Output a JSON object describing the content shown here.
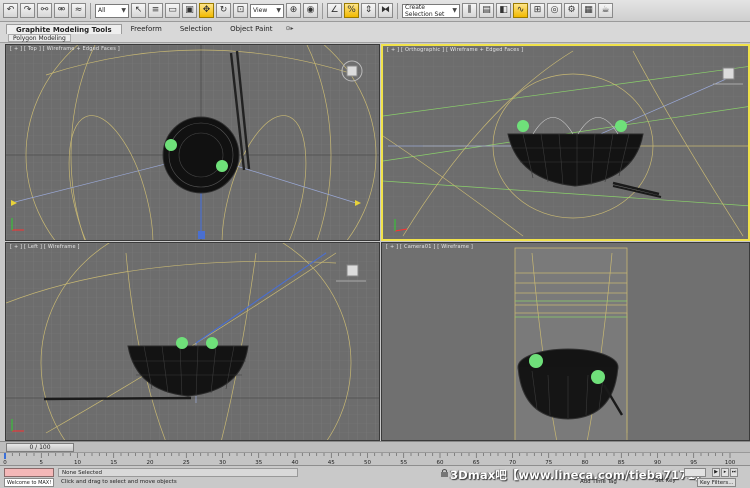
{
  "toolbar": {
    "filter_select": "All",
    "view_select": "View",
    "named_selection_placeholder": "Create Selection Set",
    "tools": [
      "undo-icon",
      "redo-icon",
      "link-icon",
      "unlink-icon",
      "bind-icon",
      "select-icon",
      "select-by-name-icon",
      "rect-region-icon",
      "window-crossing-icon",
      "move-icon",
      "rotate-icon",
      "scale-icon",
      "pivot-icon",
      "snap-icon",
      "angle-snap-icon",
      "percent-snap-icon",
      "spinner-snap-icon",
      "mirror-icon",
      "align-icon",
      "layer-icon",
      "graphite-icon",
      "curve-editor-icon",
      "schematic-icon",
      "material-editor-icon",
      "render-setup-icon",
      "rendered-frame-icon",
      "render-icon"
    ]
  },
  "ribbon": {
    "tabs": [
      "Graphite Modeling Tools",
      "Freeform",
      "Selection",
      "Object Paint"
    ],
    "active_tab": 0,
    "extra": "⊙▸",
    "panel_label": "Polygon Modeling"
  },
  "viewports": [
    {
      "id": "top",
      "label": "[ + ] [ Top ] [ Wireframe + Edged Faces ]",
      "active": false
    },
    {
      "id": "ortho",
      "label": "[ + ] [ Orthographic ] [ Wireframe + Edged Faces ]",
      "active": true
    },
    {
      "id": "left",
      "label": "[ + ] [ Left ] [ Wireframe ]",
      "active": false
    },
    {
      "id": "camera",
      "label": "[ + ] [ Camera01 ] [ Wireframe ]",
      "active": false
    }
  ],
  "timeline": {
    "handle_label": "0 / 100",
    "current_frame": 0,
    "total_frames": 100,
    "ticks": [
      "0",
      "5",
      "10",
      "15",
      "20",
      "25",
      "30",
      "35",
      "40",
      "45",
      "50",
      "55",
      "60",
      "65",
      "70",
      "75",
      "80",
      "85",
      "90",
      "95",
      "100"
    ]
  },
  "status": {
    "welcome": "Welcome to MAX!",
    "selection": "None Selected",
    "prompt": "Click and drag to select and move objects",
    "add_time_tag": "Add Time Tag",
    "set_key": "Set Key",
    "key_filters": "Key Filters...",
    "watermark": "3Dmax吧【www.lineca.com/tieba7171】"
  },
  "colors": {
    "viewport_bg": "#6d6d6d",
    "active_border": "#f0e24a",
    "wire_yellow": "#c8b873",
    "wire_black": "#0a0a0a",
    "bowl_green": "#6fe07a"
  }
}
